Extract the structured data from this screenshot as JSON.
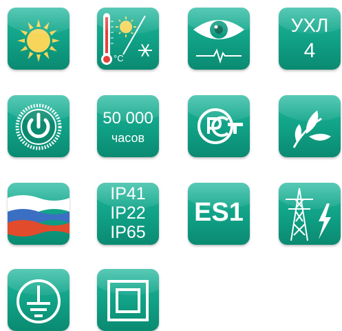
{
  "icons": {
    "sun": "sun-icon",
    "temperature": "thermometer-sun-snowflake-icon",
    "eye": "eye-icon",
    "climate": "climate-class-icon",
    "power": "power-button-icon",
    "lifetime": "lifetime-hours-icon",
    "rst": "rst-certification-icon",
    "eco": "leaf-eco-icon",
    "flag": "russian-flag-icon",
    "ip": "ip-rating-icon",
    "es1": "es1-safety-class-icon",
    "tower": "power-line-lightning-icon",
    "ground": "ground-earth-icon",
    "double_insulation": "double-insulation-icon"
  },
  "labels": {
    "celsius": "°C",
    "climate_line1": "УХЛ",
    "climate_line2": "4",
    "hours_value": "50 000",
    "hours_unit": "часов",
    "ip1": "IP41",
    "ip2": "IP22",
    "ip3": "IP65",
    "es1": "ES1"
  },
  "colors": {
    "tile_top": "#1fb79c",
    "tile_bottom": "#0a8a71",
    "sun": "#f6d55a",
    "thermo_red": "#e2423a",
    "flag_white": "#ffffff",
    "flag_blue": "#3a6fc3",
    "flag_red": "#e24b2c"
  }
}
